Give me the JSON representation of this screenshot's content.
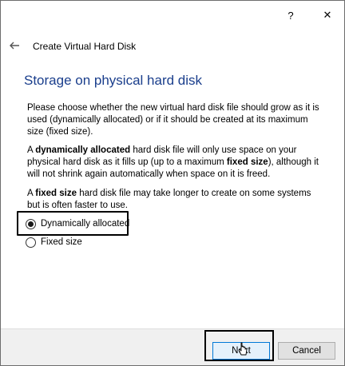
{
  "titlebar": {
    "help_label": "?",
    "close_label": "✕"
  },
  "header": {
    "back_icon": "arrow-left-icon",
    "title": "Create Virtual Hard Disk"
  },
  "page": {
    "heading": "Storage on physical hard disk",
    "para1": "Please choose whether the new virtual hard disk file should grow as it is used (dynamically allocated) or if it should be created at its maximum size (fixed size).",
    "para2_a": "A ",
    "para2_b": "dynamically allocated",
    "para2_c": " hard disk file will only use space on your physical hard disk as it fills up (up to a maximum ",
    "para2_d": "fixed size",
    "para2_e": "), although it will not shrink again automatically when space on it is freed.",
    "para3_a": "A ",
    "para3_b": "fixed size",
    "para3_c": " hard disk file may take longer to create on some systems but is often faster to use."
  },
  "options": {
    "dynamic_label": "Dynamically allocated",
    "dynamic_checked": true,
    "fixed_label": "Fixed size",
    "fixed_checked": false
  },
  "footer": {
    "next_label": "Next",
    "cancel_label": "Cancel"
  },
  "icons": {
    "cursor": "mouse-pointer-icon"
  }
}
